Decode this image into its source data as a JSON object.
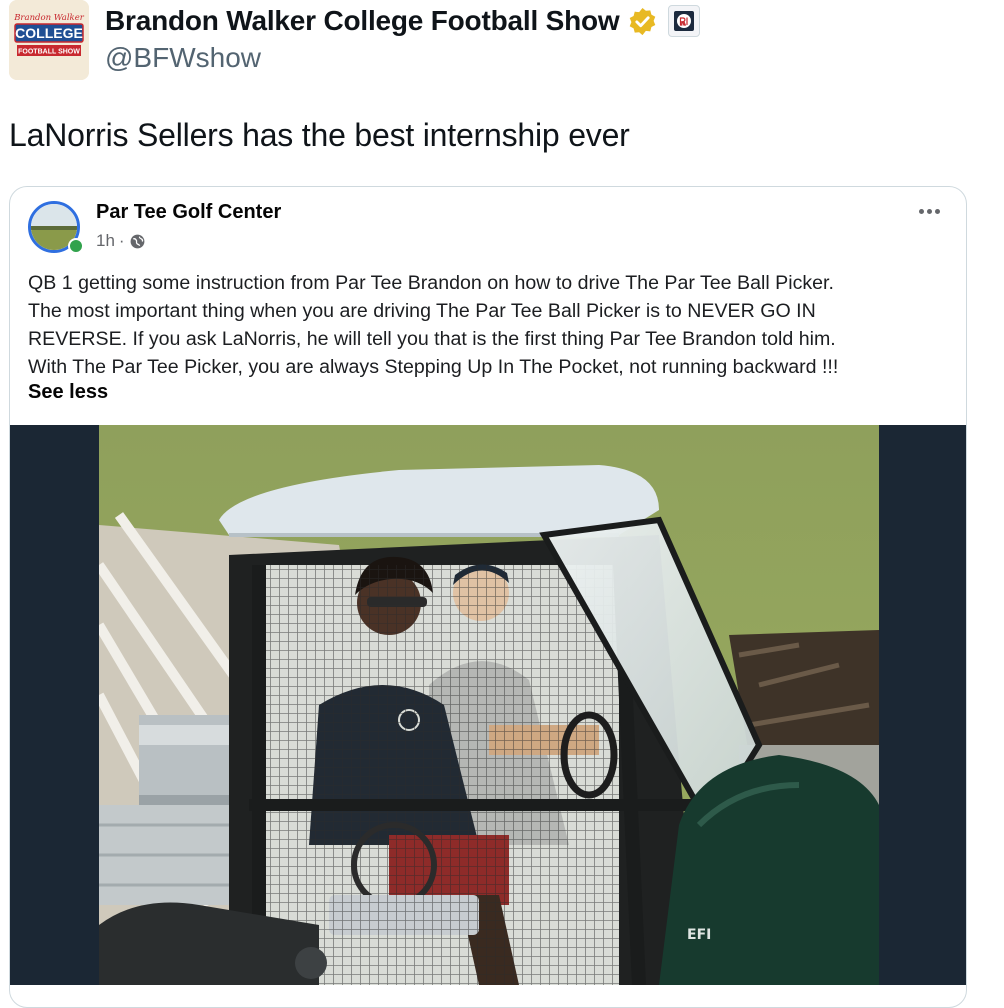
{
  "tweet": {
    "avatar": {
      "script_text": "Brandon Walker",
      "block_text": "COLLEGE",
      "sub_text": "FOOTBALL SHOW"
    },
    "display_name": "Brandon Walker College Football Show",
    "verified_icon": "verified-gold-badge-icon",
    "affiliate_icon": "barstool-affiliate-badge-icon",
    "handle": "@BFWshow",
    "text": "LaNorris Sellers has the best internship ever"
  },
  "embedded_post": {
    "page_name": "Par Tee Golf Center",
    "time": "1h",
    "separator": "·",
    "audience_icon": "globe-icon",
    "more_icon": "more-options-icon",
    "lines": [
      "QB 1 getting some instruction from Par Tee Brandon on how to drive The Par Tee Ball Picker.",
      "The most important thing when you are driving The Par Tee Ball Picker is to NEVER GO IN",
      "REVERSE.  If you ask LaNorris, he will tell you that is the first thing Par Tee Brandon told him.",
      "With The Par Tee Picker, you are always Stepping Up In The Pocket, not running backward !!!"
    ],
    "see_less": "See less",
    "photo": {
      "vehicle_badge": "EFI"
    }
  },
  "colors": {
    "verified_gold": "#e8b923",
    "fb_ring": "#2f6fe0",
    "online_dot": "#31a24c",
    "letterbox": "#1b2734"
  }
}
